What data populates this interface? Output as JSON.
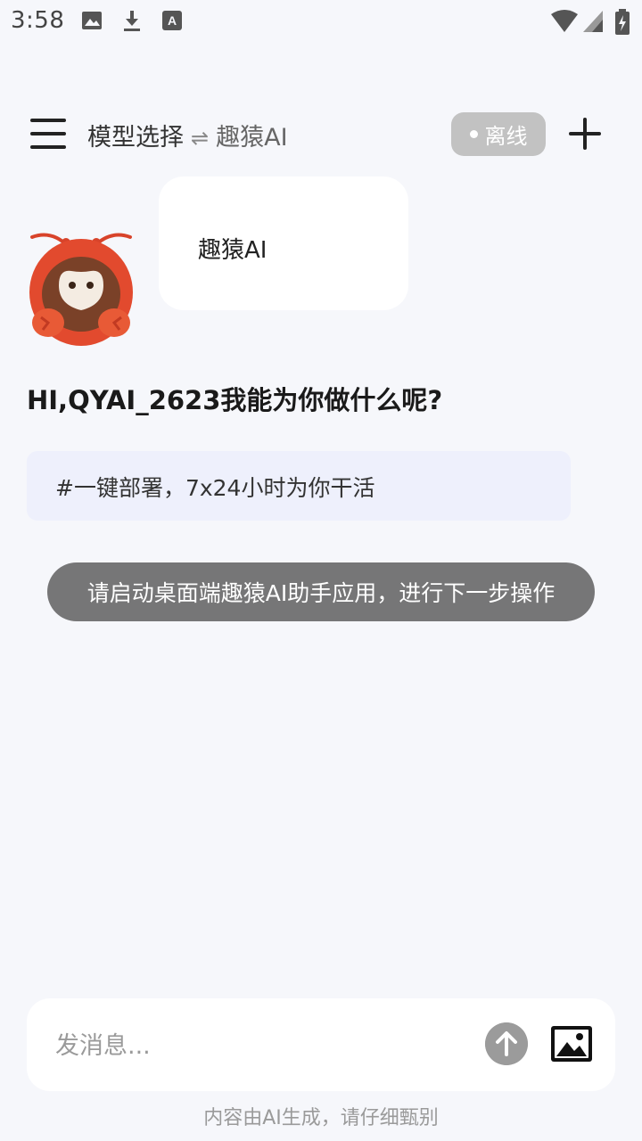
{
  "status_bar": {
    "time": "3:58",
    "left_icons": [
      "image-icon",
      "download-icon",
      "text-app-icon"
    ],
    "right_icons": [
      "wifi-icon",
      "signal-icon",
      "battery-charging-icon"
    ]
  },
  "header": {
    "menu_icon": "hamburger-menu-icon",
    "model_select_label": "模型选择",
    "swap_symbol": "⇌",
    "model_name": "趣猿AI",
    "status_label": "离线",
    "add_icon": "plus-icon"
  },
  "chat": {
    "avatar": "monkey-lobster-mascot",
    "bubble_text": "趣猿AI",
    "greeting": "HI,QYAI_2623我能为你做什么呢?",
    "tag_text": "#一键部署，7x24小时为你干活"
  },
  "toast": {
    "text": "请启动桌面端趣猿AI助手应用，进行下一步操作"
  },
  "input": {
    "placeholder": "发消息...",
    "send_icon": "arrow-up-icon",
    "image_icon": "image-icon"
  },
  "footer": {
    "disclaimer": "内容由AI生成，请仔细甄别"
  },
  "colors": {
    "background": "#f6f7fb",
    "badge_bg": "#c2c2c2",
    "tag_bg": "#eef0fc",
    "toast_bg": "#646464",
    "mascot": "#e24a2e"
  }
}
